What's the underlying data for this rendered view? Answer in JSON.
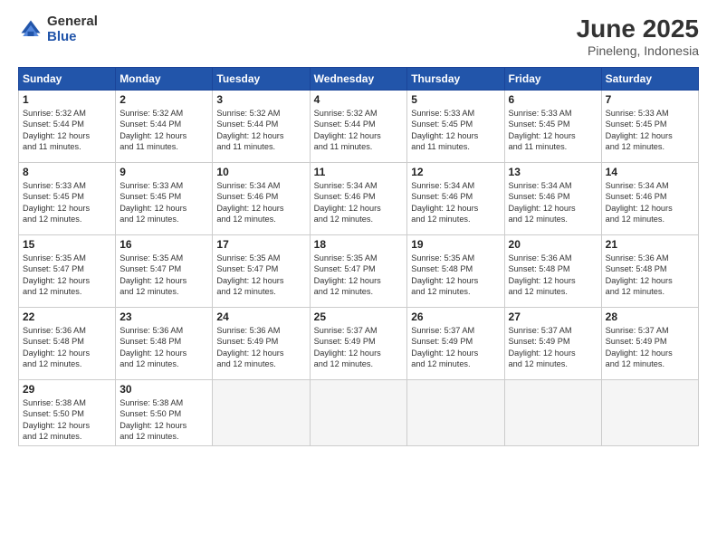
{
  "logo": {
    "general": "General",
    "blue": "Blue"
  },
  "title": "June 2025",
  "location": "Pineleng, Indonesia",
  "days_of_week": [
    "Sunday",
    "Monday",
    "Tuesday",
    "Wednesday",
    "Thursday",
    "Friday",
    "Saturday"
  ],
  "weeks": [
    [
      {
        "num": "1",
        "sunrise": "5:32 AM",
        "sunset": "5:44 PM",
        "daylight": "12 hours and 11 minutes."
      },
      {
        "num": "2",
        "sunrise": "5:32 AM",
        "sunset": "5:44 PM",
        "daylight": "12 hours and 11 minutes."
      },
      {
        "num": "3",
        "sunrise": "5:32 AM",
        "sunset": "5:44 PM",
        "daylight": "12 hours and 11 minutes."
      },
      {
        "num": "4",
        "sunrise": "5:32 AM",
        "sunset": "5:44 PM",
        "daylight": "12 hours and 11 minutes."
      },
      {
        "num": "5",
        "sunrise": "5:33 AM",
        "sunset": "5:45 PM",
        "daylight": "12 hours and 11 minutes."
      },
      {
        "num": "6",
        "sunrise": "5:33 AM",
        "sunset": "5:45 PM",
        "daylight": "12 hours and 11 minutes."
      },
      {
        "num": "7",
        "sunrise": "5:33 AM",
        "sunset": "5:45 PM",
        "daylight": "12 hours and 12 minutes."
      }
    ],
    [
      {
        "num": "8",
        "sunrise": "5:33 AM",
        "sunset": "5:45 PM",
        "daylight": "12 hours and 12 minutes."
      },
      {
        "num": "9",
        "sunrise": "5:33 AM",
        "sunset": "5:45 PM",
        "daylight": "12 hours and 12 minutes."
      },
      {
        "num": "10",
        "sunrise": "5:34 AM",
        "sunset": "5:46 PM",
        "daylight": "12 hours and 12 minutes."
      },
      {
        "num": "11",
        "sunrise": "5:34 AM",
        "sunset": "5:46 PM",
        "daylight": "12 hours and 12 minutes."
      },
      {
        "num": "12",
        "sunrise": "5:34 AM",
        "sunset": "5:46 PM",
        "daylight": "12 hours and 12 minutes."
      },
      {
        "num": "13",
        "sunrise": "5:34 AM",
        "sunset": "5:46 PM",
        "daylight": "12 hours and 12 minutes."
      },
      {
        "num": "14",
        "sunrise": "5:34 AM",
        "sunset": "5:46 PM",
        "daylight": "12 hours and 12 minutes."
      }
    ],
    [
      {
        "num": "15",
        "sunrise": "5:35 AM",
        "sunset": "5:47 PM",
        "daylight": "12 hours and 12 minutes."
      },
      {
        "num": "16",
        "sunrise": "5:35 AM",
        "sunset": "5:47 PM",
        "daylight": "12 hours and 12 minutes."
      },
      {
        "num": "17",
        "sunrise": "5:35 AM",
        "sunset": "5:47 PM",
        "daylight": "12 hours and 12 minutes."
      },
      {
        "num": "18",
        "sunrise": "5:35 AM",
        "sunset": "5:47 PM",
        "daylight": "12 hours and 12 minutes."
      },
      {
        "num": "19",
        "sunrise": "5:35 AM",
        "sunset": "5:48 PM",
        "daylight": "12 hours and 12 minutes."
      },
      {
        "num": "20",
        "sunrise": "5:36 AM",
        "sunset": "5:48 PM",
        "daylight": "12 hours and 12 minutes."
      },
      {
        "num": "21",
        "sunrise": "5:36 AM",
        "sunset": "5:48 PM",
        "daylight": "12 hours and 12 minutes."
      }
    ],
    [
      {
        "num": "22",
        "sunrise": "5:36 AM",
        "sunset": "5:48 PM",
        "daylight": "12 hours and 12 minutes."
      },
      {
        "num": "23",
        "sunrise": "5:36 AM",
        "sunset": "5:48 PM",
        "daylight": "12 hours and 12 minutes."
      },
      {
        "num": "24",
        "sunrise": "5:36 AM",
        "sunset": "5:49 PM",
        "daylight": "12 hours and 12 minutes."
      },
      {
        "num": "25",
        "sunrise": "5:37 AM",
        "sunset": "5:49 PM",
        "daylight": "12 hours and 12 minutes."
      },
      {
        "num": "26",
        "sunrise": "5:37 AM",
        "sunset": "5:49 PM",
        "daylight": "12 hours and 12 minutes."
      },
      {
        "num": "27",
        "sunrise": "5:37 AM",
        "sunset": "5:49 PM",
        "daylight": "12 hours and 12 minutes."
      },
      {
        "num": "28",
        "sunrise": "5:37 AM",
        "sunset": "5:49 PM",
        "daylight": "12 hours and 12 minutes."
      }
    ],
    [
      {
        "num": "29",
        "sunrise": "5:38 AM",
        "sunset": "5:50 PM",
        "daylight": "12 hours and 12 minutes."
      },
      {
        "num": "30",
        "sunrise": "5:38 AM",
        "sunset": "5:50 PM",
        "daylight": "12 hours and 12 minutes."
      },
      null,
      null,
      null,
      null,
      null
    ]
  ],
  "labels": {
    "sunrise": "Sunrise:",
    "sunset": "Sunset:",
    "daylight": "Daylight:"
  }
}
